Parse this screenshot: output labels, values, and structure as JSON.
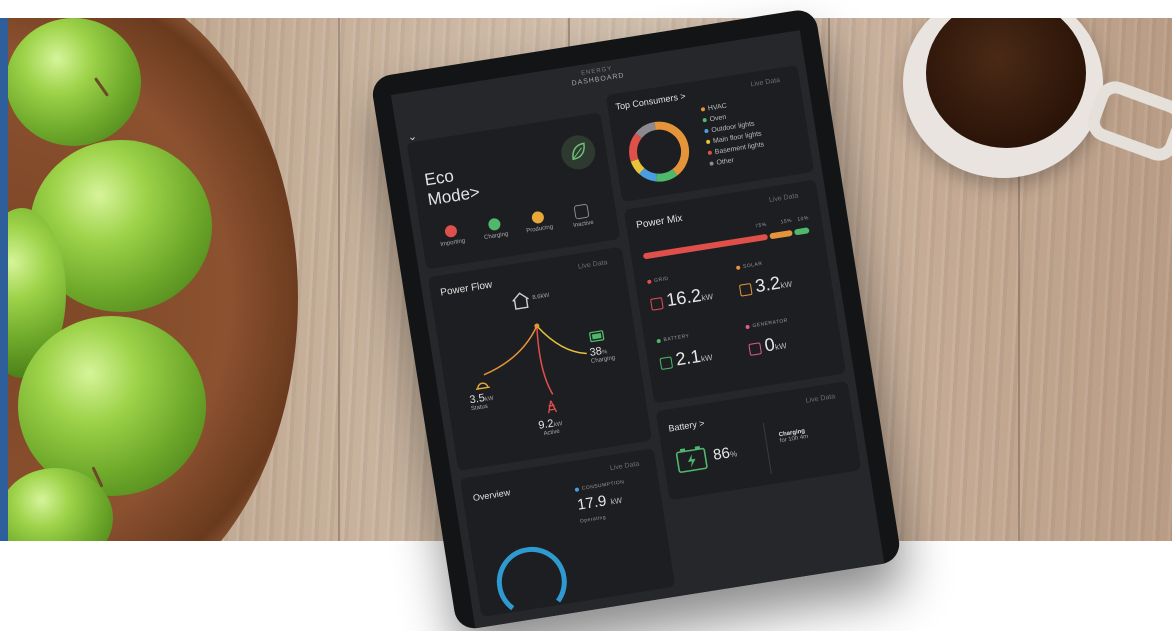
{
  "dashboard": {
    "header_small": "ENERGY",
    "header_title": "DASHBOARD"
  },
  "eco": {
    "title_line1": "Eco",
    "title_line2": "Mode>",
    "states": [
      {
        "label": "Importing",
        "color": "#e0504b"
      },
      {
        "label": "Charging",
        "color": "#4fb86a"
      },
      {
        "label": "Producing",
        "color": "#e7a83a"
      },
      {
        "label": "Inactive",
        "color": "#8a8a90"
      }
    ]
  },
  "consumers": {
    "title": "Top Consumers >",
    "live": "Live Data",
    "legend": [
      {
        "label": "HVAC",
        "color": "#e6943a"
      },
      {
        "label": "Oven",
        "color": "#4fb86a"
      },
      {
        "label": "Outdoor lights",
        "color": "#4a9ee0"
      },
      {
        "label": "Main floor lights",
        "color": "#e7c23a"
      },
      {
        "label": "Basement lights",
        "color": "#e0504b"
      },
      {
        "label": "Other",
        "color": "#8a8a90"
      }
    ],
    "donut_shares": [
      0.42,
      0.12,
      0.1,
      0.08,
      0.16,
      0.12
    ]
  },
  "power_mix": {
    "title": "Power Mix",
    "live": "Live Data",
    "segments": [
      {
        "label": "75%",
        "value": 75,
        "color": "#e0504b"
      },
      {
        "label": "15%",
        "value": 15,
        "color": "#e6943a"
      },
      {
        "label": "10%",
        "value": 10,
        "color": "#4fb86a"
      }
    ],
    "tiles": [
      {
        "label": "GRID",
        "value": "16.2",
        "unit": "kW",
        "color": "#e0504b"
      },
      {
        "label": "SOLAR",
        "value": "3.2",
        "unit": "kW",
        "color": "#e6943a"
      },
      {
        "label": "BATTERY",
        "value": "2.1",
        "unit": "kW",
        "color": "#4fb86a"
      },
      {
        "label": "GENERATOR",
        "value": "0",
        "unit": "kW",
        "color": "#e05a8a"
      }
    ]
  },
  "power_flow": {
    "title": "Power Flow",
    "live": "Live Data",
    "home_value": "8.6kW",
    "solar_value": "3.5",
    "solar_unit": "kW",
    "solar_status": "Status",
    "battery_value": "38",
    "battery_unit": "%",
    "battery_status": "Charging",
    "grid_value": "9.2",
    "grid_unit": "kW",
    "grid_status": "Active"
  },
  "battery": {
    "title": "Battery >",
    "live": "Live Data",
    "value": "86",
    "unit": "%",
    "status": "Charging",
    "time": "for 10h 4m"
  },
  "overview": {
    "title": "Overview",
    "live": "Live Data",
    "consumption_label": "CONSUMPTION",
    "consumption_value": "17.9",
    "consumption_unit": "kW",
    "sub": "Operating"
  }
}
